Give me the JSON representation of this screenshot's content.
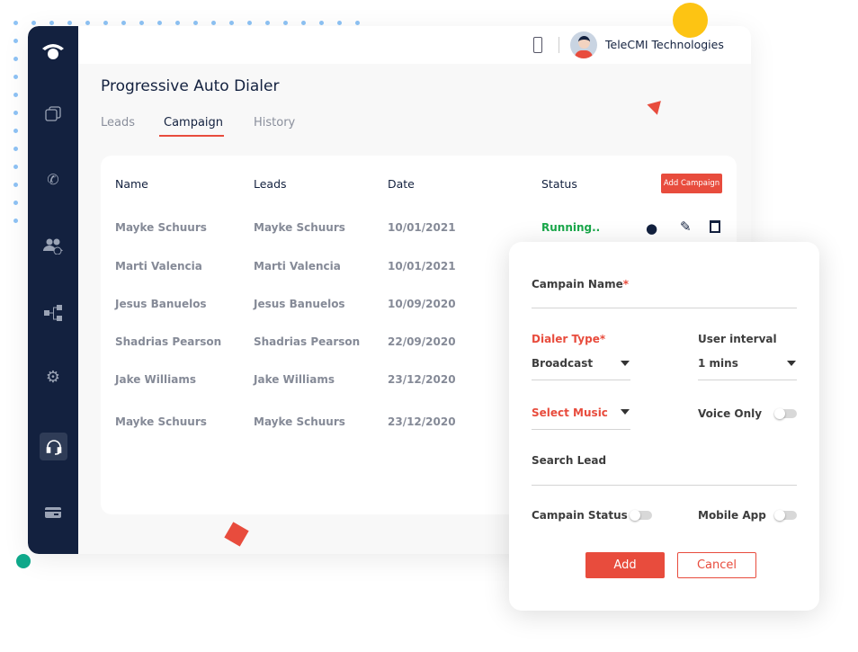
{
  "header": {
    "company": "TeleCMI Technologies"
  },
  "page": {
    "title": "Progressive Auto Dialer"
  },
  "tabs": [
    {
      "label": "Leads"
    },
    {
      "label": "Campaign"
    },
    {
      "label": "History"
    }
  ],
  "table": {
    "columns": [
      "Name",
      "Leads",
      "Date",
      "Status"
    ],
    "add_button": "Add Campaign",
    "rows": [
      {
        "name": "Mayke Schuurs",
        "leads": "Mayke Schuurs",
        "date": "10/01/2021",
        "status": "Running.."
      },
      {
        "name": "Marti Valencia",
        "leads": "Marti Valencia",
        "date": "10/01/2021",
        "status": ""
      },
      {
        "name": "Jesus Banuelos",
        "leads": "Jesus Banuelos",
        "date": "10/09/2020",
        "status": ""
      },
      {
        "name": "Shadrias Pearson",
        "leads": "Shadrias Pearson",
        "date": "22/09/2020",
        "status": ""
      },
      {
        "name": "Jake Williams",
        "leads": "Jake Williams",
        "date": "23/12/2020",
        "status": ""
      },
      {
        "name": "Mayke Schuurs",
        "leads": "Mayke Schuurs",
        "date": "23/12/2020",
        "status": ""
      }
    ]
  },
  "modal": {
    "campaign_name_label": "Campain Name",
    "required": "*",
    "dialer_type_label": "Dialer Type",
    "dialer_type_value": "Broadcast",
    "user_interval_label": "User interval",
    "user_interval_value": "1 mins",
    "select_music": "Select Music",
    "voice_only_label": "Voice Only",
    "voice_only": false,
    "search_lead_label": "Search Lead",
    "campaign_status_label": "Campain Status",
    "campaign_status": false,
    "mobile_app_label": "Mobile App",
    "mobile_app": false,
    "add": "Add",
    "cancel": "Cancel"
  },
  "colors": {
    "accent": "#e84c3d",
    "sidebar": "#13213f",
    "running": "#1aa84b",
    "yellow": "#fdc413",
    "teal": "#0ea88a"
  }
}
